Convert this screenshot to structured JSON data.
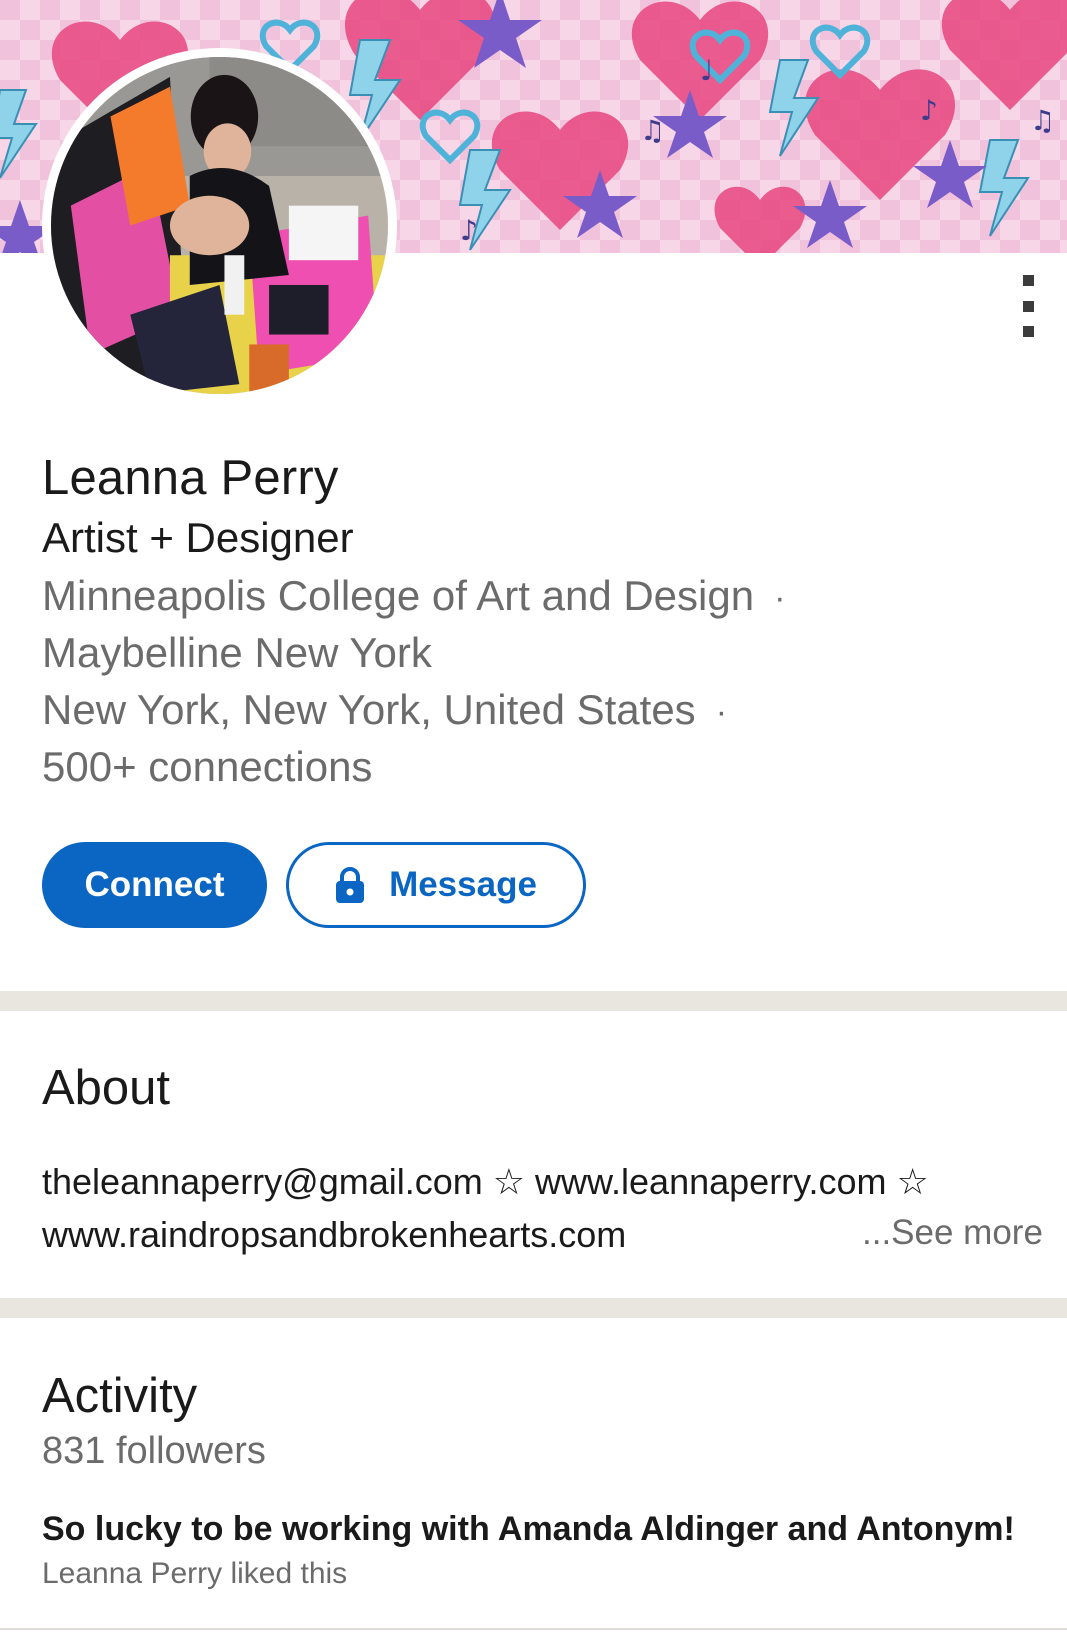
{
  "profile": {
    "name": "Leanna Perry",
    "headline": "Artist + Designer",
    "school": "Minneapolis College of Art and Design",
    "company": "Maybelline New York",
    "location": "New York, New York, United States",
    "connections": "500+ connections",
    "separator": "·"
  },
  "actions": {
    "connect_label": "Connect",
    "message_label": "Message"
  },
  "about": {
    "title": "About",
    "line1": "theleannaperry@gmail.com ☆ www.leannaperry.com ☆",
    "line2": "www.raindropsandbrokenhearts.com",
    "see_more": "...See more"
  },
  "activity": {
    "title": "Activity",
    "followers": "831 followers",
    "post_title": "So lucky to be working with Amanda Aldinger and Antonym!",
    "post_meta": "Leanna Perry liked this"
  },
  "icons": {
    "more": "more-vertical-icon",
    "lock": "lock-icon"
  },
  "colors": {
    "accent": "#0a66c2",
    "divider": "#e9e5df",
    "secondary_text": "#6b6b6b"
  }
}
